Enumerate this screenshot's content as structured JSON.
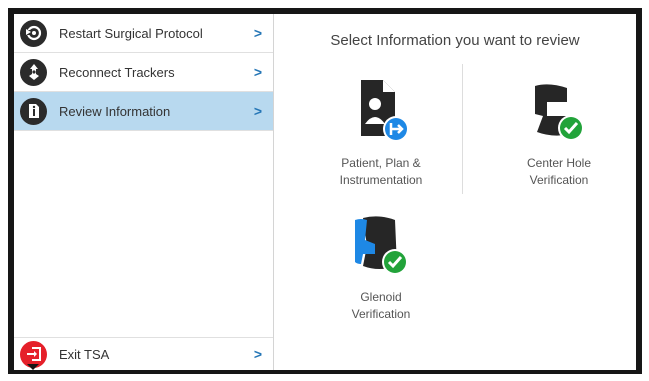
{
  "sidebar": {
    "items": [
      {
        "label": "Restart Surgical Protocol",
        "icon": "restart-icon",
        "color": "#2b2b2b"
      },
      {
        "label": "Reconnect Trackers",
        "icon": "tracker-icon",
        "color": "#2b2b2b"
      },
      {
        "label": "Review Information",
        "icon": "info-document-icon",
        "color": "#2b2b2b"
      }
    ],
    "active_index": 2,
    "exit": {
      "label": "Exit TSA",
      "icon": "exit-icon",
      "color": "#e5202a"
    },
    "chevron": ">"
  },
  "main": {
    "title": "Select Information you want to review",
    "tiles": [
      {
        "caption_line1": "Patient, Plan &",
        "caption_line2": "Instrumentation",
        "icon": "patient-plan-icon"
      },
      {
        "caption_line1": "Center Hole",
        "caption_line2": "Verification",
        "icon": "center-hole-check-icon"
      },
      {
        "caption_line1": "Glenoid",
        "caption_line2": "Verification",
        "icon": "glenoid-check-icon"
      }
    ]
  },
  "colors": {
    "accent_blue": "#1e88e5",
    "check_green": "#22a33a",
    "active_bg": "#b8d9ef",
    "exit_red": "#e5202a"
  }
}
